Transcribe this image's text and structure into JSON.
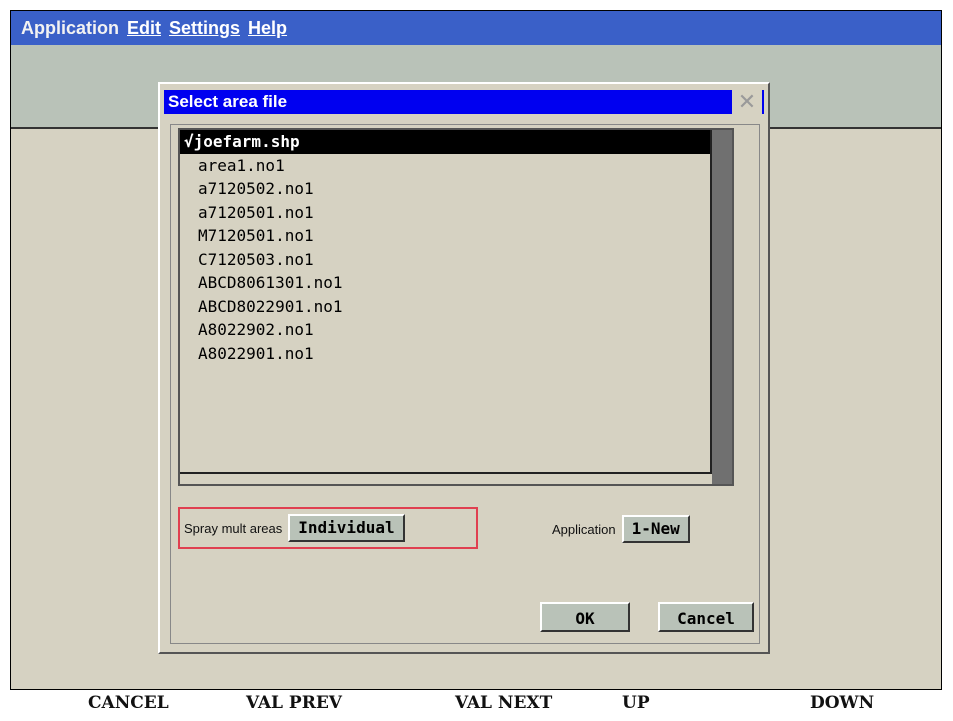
{
  "menubar": {
    "items": [
      {
        "label": "Application"
      },
      {
        "label": "Edit"
      },
      {
        "label": "Settings"
      },
      {
        "label": "Help"
      }
    ]
  },
  "dialog": {
    "title": "Select area file",
    "close_icon": "close-icon",
    "files": [
      "√joefarm.shp",
      "area1.no1",
      "a7120502.no1",
      "a7120501.no1",
      "M7120501.no1",
      "C7120503.no1",
      "ABCD8061301.no1",
      "ABCD8022901.no1",
      "A8022902.no1",
      "A8022901.no1"
    ],
    "selected_index": 0,
    "spray_label": "Spray mult areas",
    "spray_value": "Individual",
    "application_label": "Application",
    "application_value": "1-New",
    "ok_label": "OK",
    "cancel_label": "Cancel"
  },
  "function_keys": [
    "CANCEL",
    "VAL PREV",
    "VAL NEXT",
    "UP",
    "DOWN"
  ],
  "colors": {
    "menubar": "#3a60c8",
    "title": "#0000f0",
    "background": "#d6d2c2",
    "highlight": "#e04050"
  }
}
